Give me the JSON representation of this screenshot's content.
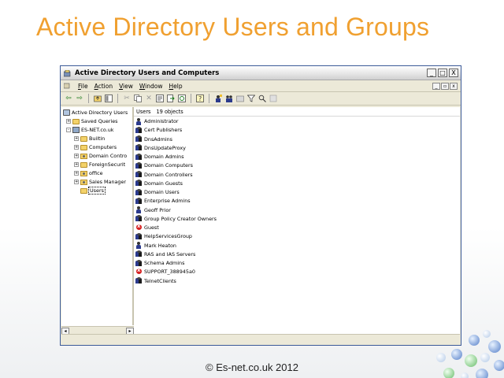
{
  "slide": {
    "title": "Active Directory Users and Groups",
    "footer": "© Es-net.co.uk 2012"
  },
  "window": {
    "title": "Active Directory Users and Computers",
    "buttons": {
      "minimize": "_",
      "maximize": "□",
      "close": "X"
    }
  },
  "menu": {
    "file": "File",
    "action": "Action",
    "view": "View",
    "window": "Window",
    "help": "Help"
  },
  "toolbar_icons": [
    "back-arrow-icon",
    "forward-arrow-icon",
    "up-folder-icon",
    "show-tree-icon",
    "cut-icon",
    "copy-icon",
    "delete-icon",
    "properties-icon",
    "export-icon",
    "refresh-icon",
    "help-icon",
    "new-user-icon",
    "new-group-icon",
    "new-ou-icon",
    "filter-icon",
    "find-icon",
    "add-to-group-icon"
  ],
  "tree": {
    "root": "Active Directory Users",
    "items": [
      {
        "label": "Saved Queries",
        "type": "folder"
      },
      {
        "label": "ES-NET.co.uk",
        "type": "domain"
      },
      {
        "label": "Builtin",
        "type": "folder"
      },
      {
        "label": "Computers",
        "type": "folder"
      },
      {
        "label": "Domain Contro",
        "type": "ou"
      },
      {
        "label": "ForeignSecurit",
        "type": "folder"
      },
      {
        "label": "office",
        "type": "ou"
      },
      {
        "label": "Sales Manager",
        "type": "ou"
      },
      {
        "label": "Users",
        "type": "folder"
      }
    ]
  },
  "list": {
    "header": {
      "folder": "Users",
      "count": "19 objects"
    },
    "rows": [
      {
        "name": "Administrator",
        "icon": "user"
      },
      {
        "name": "Cert Publishers",
        "icon": "group"
      },
      {
        "name": "DnsAdmins",
        "icon": "group"
      },
      {
        "name": "DnsUpdateProxy",
        "icon": "group"
      },
      {
        "name": "Domain Admins",
        "icon": "group"
      },
      {
        "name": "Domain Computers",
        "icon": "group"
      },
      {
        "name": "Domain Controllers",
        "icon": "group"
      },
      {
        "name": "Domain Guests",
        "icon": "group"
      },
      {
        "name": "Domain Users",
        "icon": "group"
      },
      {
        "name": "Enterprise Admins",
        "icon": "group"
      },
      {
        "name": "Geoff Prior",
        "icon": "user"
      },
      {
        "name": "Group Policy Creator Owners",
        "icon": "group"
      },
      {
        "name": "Guest",
        "icon": "disabled"
      },
      {
        "name": "HelpServicesGroup",
        "icon": "group"
      },
      {
        "name": "Mark Heaton",
        "icon": "user"
      },
      {
        "name": "RAS and IAS Servers",
        "icon": "group"
      },
      {
        "name": "Schema Admins",
        "icon": "group"
      },
      {
        "name": "SUPPORT_388945a0",
        "icon": "disabled"
      },
      {
        "name": "TelnetClients",
        "icon": "group"
      }
    ]
  },
  "colors": {
    "title": "#f0a030",
    "window_border": "#3b5a98"
  }
}
